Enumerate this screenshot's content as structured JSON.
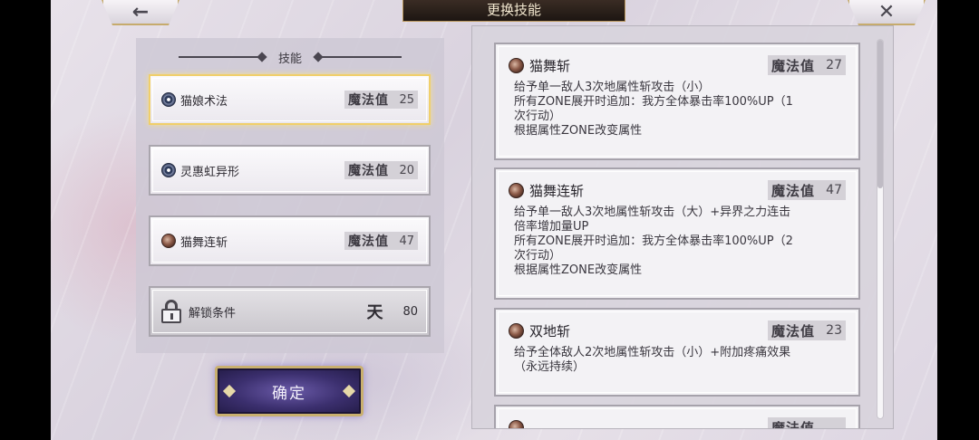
{
  "header": {
    "title": "更换技能",
    "back_symbol": "←",
    "close_symbol": "✕"
  },
  "left_panel": {
    "heading": "技能",
    "slots": [
      {
        "name": "猫娘术法",
        "mp_label": "魔法值",
        "mp": "25",
        "icon": "flower-icon",
        "selected": true
      },
      {
        "name": "灵惠虹异形",
        "mp_label": "魔法值",
        "mp": "20",
        "icon": "flower-icon",
        "selected": false
      },
      {
        "name": "猫舞连斩",
        "mp_label": "魔法值",
        "mp": "47",
        "icon": "cat-icon",
        "selected": false
      }
    ],
    "locked_slot": {
      "label": "解锁条件",
      "glyph": "天",
      "value": "80",
      "icon": "lock-icon"
    }
  },
  "confirm_button": {
    "label": "确定"
  },
  "skill_list": [
    {
      "name": "猫舞斩",
      "mp_label": "魔法值",
      "mp": "27",
      "icon": "cat-icon",
      "desc": "给予单一敌人3次地属性斩攻击（小）\n所有ZONE展开时追加：我方全体暴击率100%UP（1\n次行动）\n根据属性ZONE改变属性"
    },
    {
      "name": "猫舞连斩",
      "mp_label": "魔法值",
      "mp": "47",
      "icon": "cat-icon",
      "desc": "给予单一敌人3次地属性斩攻击（大）+异界之力连击\n倍率增加量UP\n所有ZONE展开时追加：我方全体暴击率100%UP（2\n次行动）\n根据属性ZONE改变属性"
    },
    {
      "name": "双地斩",
      "mp_label": "魔法值",
      "mp": "23",
      "icon": "cat-icon",
      "desc": "给予全体敌人2次地属性斩攻击（小）+附加疼痛效果\n（永远持续）"
    },
    {
      "name": "",
      "mp_label": "魔法值",
      "mp": "",
      "icon": "cat-icon",
      "desc": ""
    }
  ],
  "colors": {
    "selected_border": "#f0cf6a",
    "confirm_bg": "#3b2f6e",
    "gold_trim": "#c9b06f"
  }
}
